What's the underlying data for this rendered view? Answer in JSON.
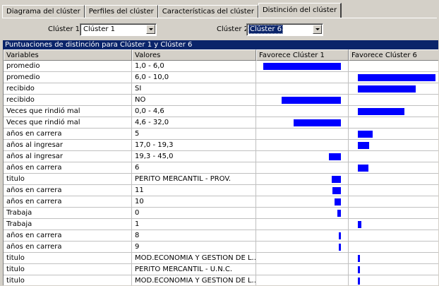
{
  "tabs": [
    {
      "label": "Diagrama del clúster"
    },
    {
      "label": "Perfiles del clúster"
    },
    {
      "label": "Características del clúster"
    },
    {
      "label": "Distinción del clúster",
      "active": true
    }
  ],
  "selectors": {
    "cluster1": {
      "label": "Clúster 1:",
      "value": "Clúster 1"
    },
    "cluster2": {
      "label": "Clúster 2:",
      "value": "Clúster 6"
    }
  },
  "grid": {
    "title": "Puntuaciones de distinción para Clúster 1 y Clúster 6",
    "columns": [
      "Variables",
      "Valores",
      "Favorece Clúster 1",
      "Favorece Clúster 6"
    ],
    "bar_color": "#0000ff",
    "rows": [
      {
        "variable": "promedio",
        "valor": "1,0 - 6,0",
        "fav1": 110,
        "fav6": 0
      },
      {
        "variable": "promedio",
        "valor": "6,0 - 10,0",
        "fav1": 0,
        "fav6": 110
      },
      {
        "variable": "recibido",
        "valor": "SI",
        "fav1": 0,
        "fav6": 82
      },
      {
        "variable": "recibido",
        "valor": "NO",
        "fav1": 84,
        "fav6": 0
      },
      {
        "variable": "Veces que rindió mal",
        "valor": "0,0 - 4,6",
        "fav1": 0,
        "fav6": 66
      },
      {
        "variable": "Veces que rindió mal",
        "valor": "4,6 - 32,0",
        "fav1": 67,
        "fav6": 0
      },
      {
        "variable": "años en carrera",
        "valor": "5",
        "fav1": 0,
        "fav6": 21
      },
      {
        "variable": "años al ingresar",
        "valor": "17,0 - 19,3",
        "fav1": 0,
        "fav6": 16
      },
      {
        "variable": "años al ingresar",
        "valor": "19,3 - 45,0",
        "fav1": 17,
        "fav6": 0
      },
      {
        "variable": "años en carrera",
        "valor": "6",
        "fav1": 0,
        "fav6": 15
      },
      {
        "variable": "titulo",
        "valor": "PERITO MERCANTIL - PROV.",
        "fav1": 13,
        "fav6": 0
      },
      {
        "variable": "años en carrera",
        "valor": "11",
        "fav1": 12,
        "fav6": 0
      },
      {
        "variable": "años en carrera",
        "valor": "10",
        "fav1": 9,
        "fav6": 0
      },
      {
        "variable": "Trabaja",
        "valor": "0",
        "fav1": 5,
        "fav6": 0
      },
      {
        "variable": "Trabaja",
        "valor": "1",
        "fav1": 0,
        "fav6": 5
      },
      {
        "variable": "años en carrera",
        "valor": "8",
        "fav1": 3,
        "fav6": 0
      },
      {
        "variable": "años en carrera",
        "valor": "9",
        "fav1": 3,
        "fav6": 0
      },
      {
        "variable": "titulo",
        "valor": "MOD.ECONOMIA Y GESTION DE L...",
        "fav1": 0,
        "fav6": 3
      },
      {
        "variable": "titulo",
        "valor": "PERITO MERCANTIL - U.N.C.",
        "fav1": 0,
        "fav6": 3
      },
      {
        "variable": "titulo",
        "valor": "MOD.ECONOMIA Y GESTION DE L...",
        "fav1": 0,
        "fav6": 3
      }
    ]
  }
}
